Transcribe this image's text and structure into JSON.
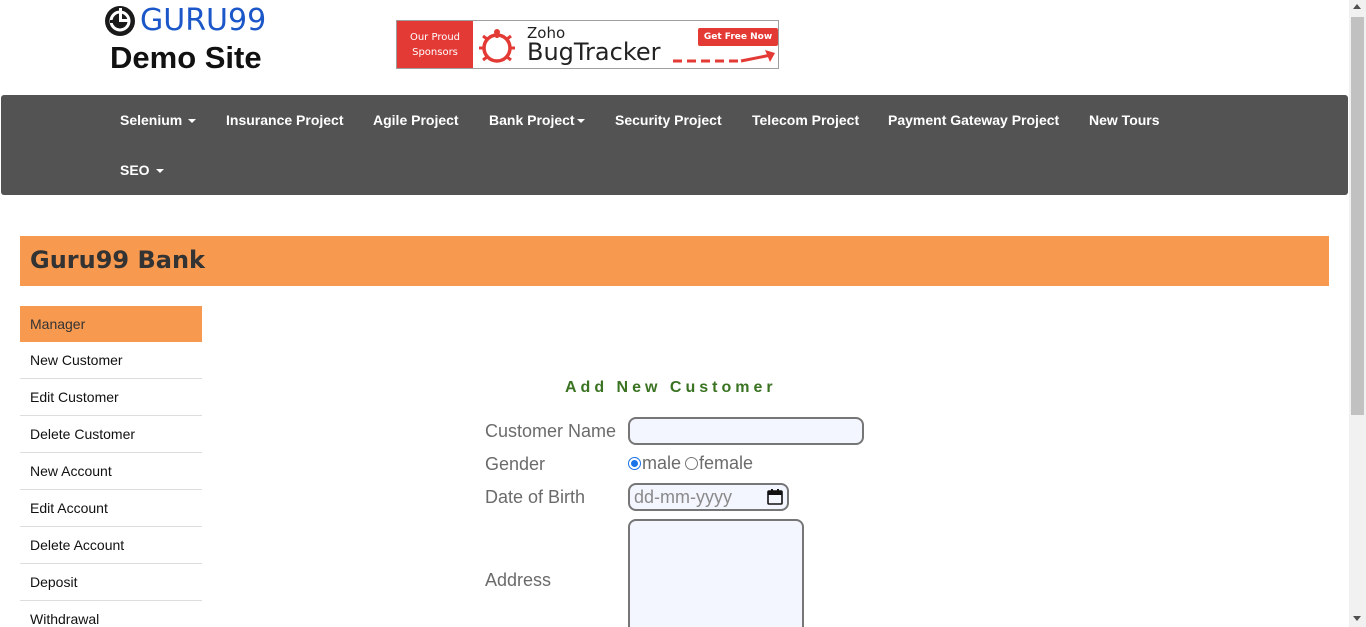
{
  "header": {
    "logo_text": "GURU99",
    "site_subtitle": "Demo Site",
    "banner": {
      "sponsor_line1": "Our Proud",
      "sponsor_line2": "Sponsors",
      "brand_small": "Zoho",
      "brand_large": "BugTracker",
      "cta": "Get Free Now"
    }
  },
  "nav": {
    "items": [
      {
        "label": "Selenium",
        "dropdown": true
      },
      {
        "label": "Insurance Project",
        "dropdown": false
      },
      {
        "label": "Agile Project",
        "dropdown": false
      },
      {
        "label": "Bank Project",
        "dropdown": true
      },
      {
        "label": "Security Project",
        "dropdown": false
      },
      {
        "label": "Telecom Project",
        "dropdown": false
      },
      {
        "label": "Payment Gateway Project",
        "dropdown": false
      },
      {
        "label": "New Tours",
        "dropdown": false
      },
      {
        "label": "SEO",
        "dropdown": true
      }
    ]
  },
  "bank": {
    "title": "Guru99 Bank"
  },
  "sidebar": {
    "items": [
      {
        "label": "Manager",
        "active": true
      },
      {
        "label": "New Customer",
        "active": false
      },
      {
        "label": "Edit Customer",
        "active": false
      },
      {
        "label": "Delete Customer",
        "active": false
      },
      {
        "label": "New Account",
        "active": false
      },
      {
        "label": "Edit Account",
        "active": false
      },
      {
        "label": "Delete Account",
        "active": false
      },
      {
        "label": "Deposit",
        "active": false
      },
      {
        "label": "Withdrawal",
        "active": false
      }
    ]
  },
  "form": {
    "title": "Add New Customer",
    "customer_name": {
      "label": "Customer Name",
      "value": ""
    },
    "gender": {
      "label": "Gender",
      "options": [
        "male",
        "female"
      ],
      "selected": "male"
    },
    "dob": {
      "label": "Date of Birth",
      "placeholder": "dd-mm-yyyy"
    },
    "address": {
      "label": "Address",
      "value": ""
    }
  },
  "colors": {
    "brand_blue": "#1b57c9",
    "nav_bg": "#535353",
    "accent_orange": "#f7994f",
    "form_title_green": "#3a7322",
    "banner_red": "#e43a35"
  }
}
